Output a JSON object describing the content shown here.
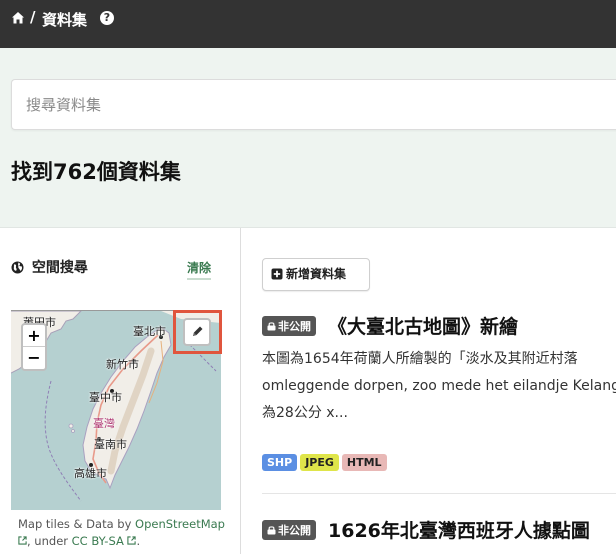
{
  "breadcrumb": {
    "separator": "/",
    "current": "資料集"
  },
  "icons": {
    "home": "home-icon",
    "help": "question-circle-icon",
    "globe": "globe-icon",
    "pencil": "pencil-icon",
    "lock": "lock-icon",
    "plus": "plus-square-icon",
    "external": "external-link-icon"
  },
  "search": {
    "placeholder": "搜尋資料集",
    "value": ""
  },
  "results": {
    "count_text": "找到762個資料集"
  },
  "spatial": {
    "title": "空間搜尋",
    "clear_label": "清除",
    "map": {
      "zoom_in": "+",
      "zoom_out": "−",
      "labels": [
        "莆田市",
        "臺北市",
        "新竹市",
        "臺中市",
        "臺灣",
        "臺南市",
        "高雄市"
      ]
    },
    "attribution": {
      "prefix": "Map tiles & Data by ",
      "osm_link": "OpenStreetMap",
      "under": ", under ",
      "license_link": "CC BY-SA",
      "suffix": "."
    }
  },
  "actions": {
    "add_dataset": "新增資料集"
  },
  "datasets": [
    {
      "badge": "非公開",
      "title": "《大臺北古地圖》新繪",
      "description_lines": [
        "本圖為1654年荷蘭人所繪製的「淡水及其附近村落",
        "omleggende dorpen, zoo mede het eilandje Kelang",
        "為28公分 x..."
      ],
      "formats": [
        "SHP",
        "JPEG",
        "HTML"
      ]
    },
    {
      "badge": "非公開",
      "title": "1626年北臺灣西班牙人據點圖"
    }
  ],
  "colors": {
    "topbar": "#333333",
    "search_bg": "#eef4f0",
    "accent": "#3a7a50",
    "highlight": "#e0553d"
  }
}
